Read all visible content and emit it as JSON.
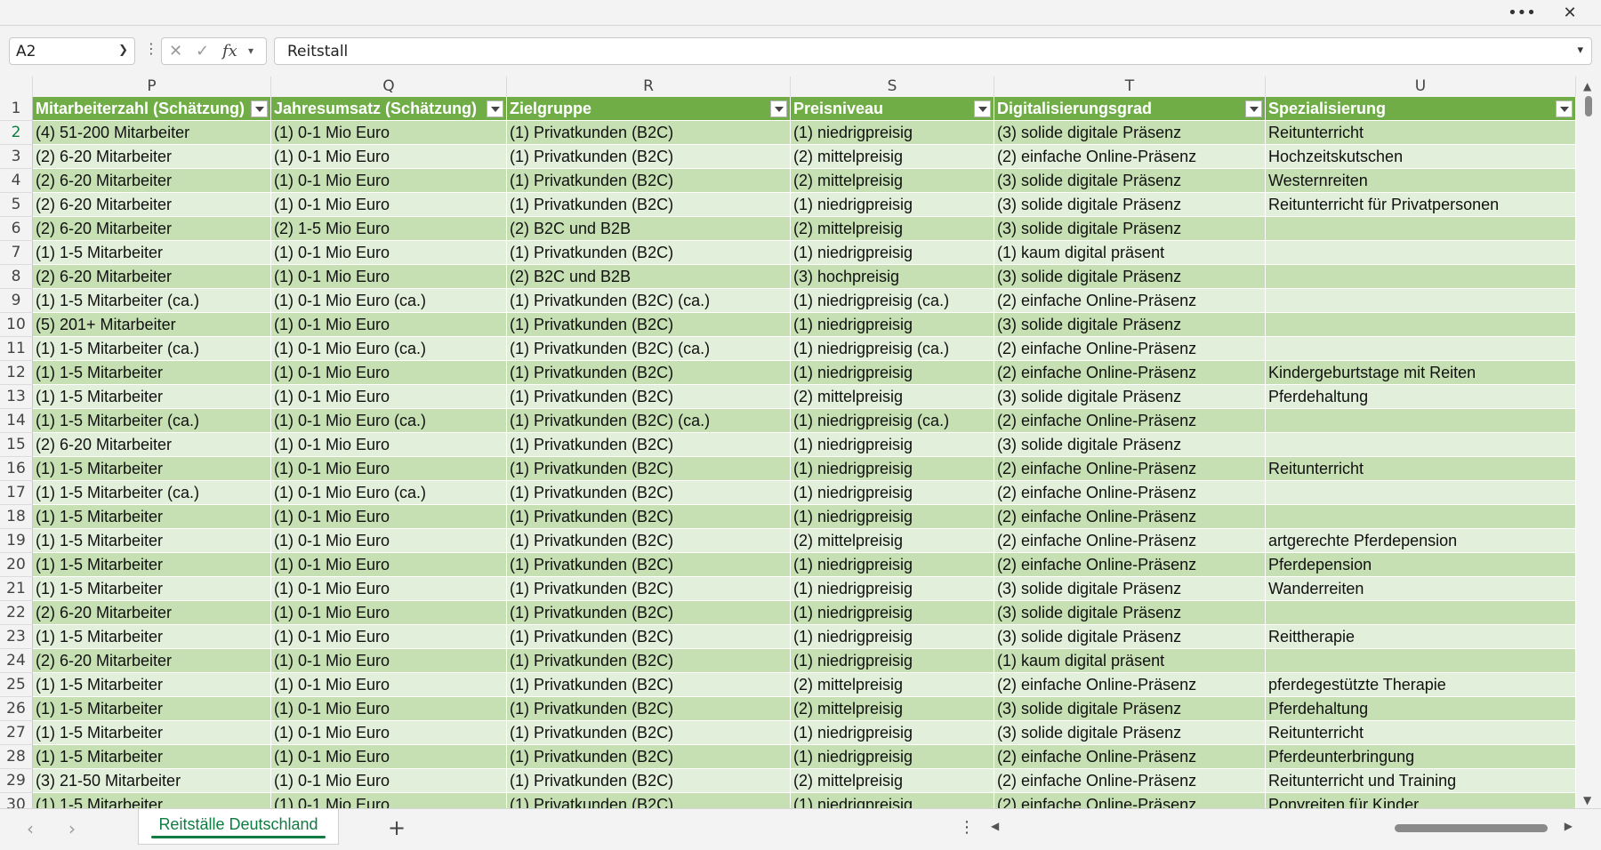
{
  "window": {
    "more_icon": "ellipsis-icon",
    "close_icon": "close-icon"
  },
  "formula_bar": {
    "name_box": "A2",
    "formula": "Reitstall",
    "fx_label": "fx"
  },
  "columns": [
    "P",
    "Q",
    "R",
    "S",
    "T",
    "U"
  ],
  "headers": [
    "Mitarbeiterzahl (Schätzung)",
    "Jahresumsatz (Schätzung)",
    "Zielgruppe",
    "Preisniveau",
    "Digitalisierungsgrad",
    "Spezialisierung"
  ],
  "rows": [
    [
      "2",
      "(4) 51-200 Mitarbeiter",
      "(1) 0-1 Mio Euro",
      "(1) Privatkunden (B2C)",
      "(1) niedrigpreisig",
      "(3) solide digitale Präsenz",
      "Reitunterricht"
    ],
    [
      "3",
      "(2) 6-20 Mitarbeiter",
      "(1) 0-1 Mio Euro",
      "(1) Privatkunden (B2C)",
      "(2) mittelpreisig",
      "(2) einfache Online-Präsenz",
      "Hochzeitskutschen"
    ],
    [
      "4",
      "(2) 6-20 Mitarbeiter",
      "(1) 0-1 Mio Euro",
      "(1) Privatkunden (B2C)",
      "(2) mittelpreisig",
      "(3) solide digitale Präsenz",
      "Westernreiten"
    ],
    [
      "5",
      "(2) 6-20 Mitarbeiter",
      "(1) 0-1 Mio Euro",
      "(1) Privatkunden (B2C)",
      "(1) niedrigpreisig",
      "(3) solide digitale Präsenz",
      "Reitunterricht für Privatpersonen"
    ],
    [
      "6",
      "(2) 6-20 Mitarbeiter",
      "(2) 1-5 Mio Euro",
      "(2) B2C und B2B",
      "(2) mittelpreisig",
      "(3) solide digitale Präsenz",
      ""
    ],
    [
      "7",
      "(1) 1-5 Mitarbeiter",
      "(1) 0-1 Mio Euro",
      "(1) Privatkunden (B2C)",
      "(1) niedrigpreisig",
      "(1) kaum digital präsent",
      ""
    ],
    [
      "8",
      "(2) 6-20 Mitarbeiter",
      "(1) 0-1 Mio Euro",
      "(2) B2C und B2B",
      "(3) hochpreisig",
      "(3) solide digitale Präsenz",
      ""
    ],
    [
      "9",
      "(1) 1-5 Mitarbeiter (ca.)",
      "(1) 0-1 Mio Euro (ca.)",
      "(1) Privatkunden (B2C) (ca.)",
      "(1) niedrigpreisig (ca.)",
      "(2) einfache Online-Präsenz",
      ""
    ],
    [
      "10",
      "(5) 201+ Mitarbeiter",
      "(1) 0-1 Mio Euro",
      "(1) Privatkunden (B2C)",
      "(1) niedrigpreisig",
      "(3) solide digitale Präsenz",
      ""
    ],
    [
      "11",
      "(1) 1-5 Mitarbeiter (ca.)",
      "(1) 0-1 Mio Euro (ca.)",
      "(1) Privatkunden (B2C) (ca.)",
      "(1) niedrigpreisig (ca.)",
      "(2) einfache Online-Präsenz",
      ""
    ],
    [
      "12",
      "(1) 1-5 Mitarbeiter",
      "(1) 0-1 Mio Euro",
      "(1) Privatkunden (B2C)",
      "(1) niedrigpreisig",
      "(2) einfache Online-Präsenz",
      "Kindergeburtstage mit Reiten"
    ],
    [
      "13",
      "(1) 1-5 Mitarbeiter",
      "(1) 0-1 Mio Euro",
      "(1) Privatkunden (B2C)",
      "(2) mittelpreisig",
      "(3) solide digitale Präsenz",
      "Pferdehaltung"
    ],
    [
      "14",
      "(1) 1-5 Mitarbeiter (ca.)",
      "(1) 0-1 Mio Euro (ca.)",
      "(1) Privatkunden (B2C) (ca.)",
      "(1) niedrigpreisig (ca.)",
      "(2) einfache Online-Präsenz",
      ""
    ],
    [
      "15",
      "(2) 6-20 Mitarbeiter",
      "(1) 0-1 Mio Euro",
      "(1) Privatkunden (B2C)",
      "(1) niedrigpreisig",
      "(3) solide digitale Präsenz",
      ""
    ],
    [
      "16",
      "(1) 1-5 Mitarbeiter",
      "(1) 0-1 Mio Euro",
      "(1) Privatkunden (B2C)",
      "(1) niedrigpreisig",
      "(2) einfache Online-Präsenz",
      "Reitunterricht"
    ],
    [
      "17",
      "(1) 1-5 Mitarbeiter (ca.)",
      "(1) 0-1 Mio Euro (ca.)",
      "(1) Privatkunden (B2C)",
      "(1) niedrigpreisig",
      "(2) einfache Online-Präsenz",
      ""
    ],
    [
      "18",
      "(1) 1-5 Mitarbeiter",
      "(1) 0-1 Mio Euro",
      "(1) Privatkunden (B2C)",
      "(1) niedrigpreisig",
      "(2) einfache Online-Präsenz",
      ""
    ],
    [
      "19",
      "(1) 1-5 Mitarbeiter",
      "(1) 0-1 Mio Euro",
      "(1) Privatkunden (B2C)",
      "(2) mittelpreisig",
      "(2) einfache Online-Präsenz",
      "artgerechte Pferdepension"
    ],
    [
      "20",
      "(1) 1-5 Mitarbeiter",
      "(1) 0-1 Mio Euro",
      "(1) Privatkunden (B2C)",
      "(1) niedrigpreisig",
      "(2) einfache Online-Präsenz",
      "Pferdepension"
    ],
    [
      "21",
      "(1) 1-5 Mitarbeiter",
      "(1) 0-1 Mio Euro",
      "(1) Privatkunden (B2C)",
      "(1) niedrigpreisig",
      "(3) solide digitale Präsenz",
      "Wanderreiten"
    ],
    [
      "22",
      "(2) 6-20 Mitarbeiter",
      "(1) 0-1 Mio Euro",
      "(1) Privatkunden (B2C)",
      "(1) niedrigpreisig",
      "(3) solide digitale Präsenz",
      ""
    ],
    [
      "23",
      "(1) 1-5 Mitarbeiter",
      "(1) 0-1 Mio Euro",
      "(1) Privatkunden (B2C)",
      "(1) niedrigpreisig",
      "(3) solide digitale Präsenz",
      "Reittherapie"
    ],
    [
      "24",
      "(2) 6-20 Mitarbeiter",
      "(1) 0-1 Mio Euro",
      "(1) Privatkunden (B2C)",
      "(1) niedrigpreisig",
      "(1) kaum digital präsent",
      ""
    ],
    [
      "25",
      "(1) 1-5 Mitarbeiter",
      "(1) 0-1 Mio Euro",
      "(1) Privatkunden (B2C)",
      "(2) mittelpreisig",
      "(2) einfache Online-Präsenz",
      "pferdegestützte Therapie"
    ],
    [
      "26",
      "(1) 1-5 Mitarbeiter",
      "(1) 0-1 Mio Euro",
      "(1) Privatkunden (B2C)",
      "(2) mittelpreisig",
      "(3) solide digitale Präsenz",
      "Pferdehaltung"
    ],
    [
      "27",
      "(1) 1-5 Mitarbeiter",
      "(1) 0-1 Mio Euro",
      "(1) Privatkunden (B2C)",
      "(1) niedrigpreisig",
      "(3) solide digitale Präsenz",
      "Reitunterricht"
    ],
    [
      "28",
      "(1) 1-5 Mitarbeiter",
      "(1) 0-1 Mio Euro",
      "(1) Privatkunden (B2C)",
      "(1) niedrigpreisig",
      "(2) einfache Online-Präsenz",
      "Pferdeunterbringung"
    ],
    [
      "29",
      "(3) 21-50 Mitarbeiter",
      "(1) 0-1 Mio Euro",
      "(1) Privatkunden (B2C)",
      "(2) mittelpreisig",
      "(2) einfache Online-Präsenz",
      "Reitunterricht und Training"
    ],
    [
      "30",
      "(1) 1-5 Mitarbeiter",
      "(1) 0-1 Mio Euro",
      "(1) Privatkunden (B2C)",
      "(1) niedrigpreisig",
      "(2) einfache Online-Präsenz",
      "Ponyreiten für Kinder"
    ]
  ],
  "header_row_number": "1",
  "sheet_tabs": {
    "active": "Reitställe Deutschland",
    "add": "+"
  },
  "colors": {
    "header_green": "#70ad47",
    "band_dark": "#c6e0b4",
    "band_light": "#e2efda",
    "accent": "#107c41"
  }
}
